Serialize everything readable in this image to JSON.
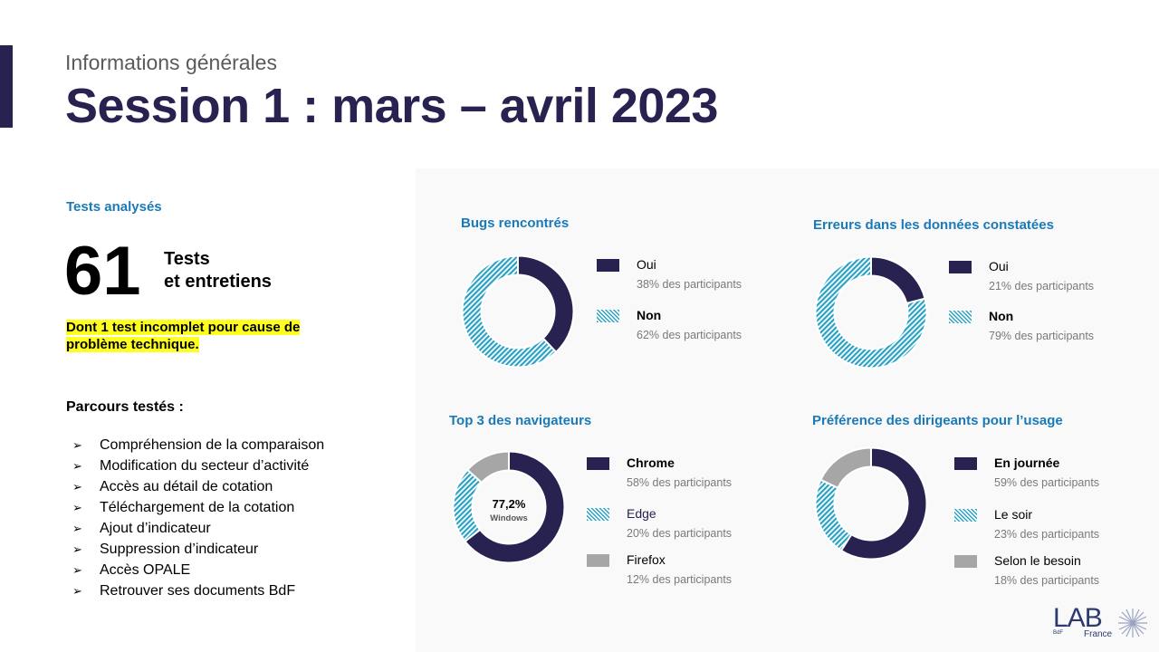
{
  "header": {
    "subtitle": "Informations générales",
    "title": "Session 1 : mars – avril 2023"
  },
  "summary": {
    "heading": "Tests analysés",
    "count": "61",
    "count_label_line1": "Tests",
    "count_label_line2": "et entretiens",
    "note": "Dont 1 test incomplet pour cause de problème technique."
  },
  "parcours": {
    "title": "Parcours testés :",
    "bullet": "➢",
    "items": [
      "Compréhension de la comparaison",
      "Modification du secteur d’activité",
      "Accès au détail de cotation",
      "Téléchargement de la cotation",
      "Ajout d’indicateur",
      "Suppression d’indicateur",
      "Accès OPALE",
      "Retrouver ses documents BdF"
    ]
  },
  "colors": {
    "navy": "#27224f",
    "teal": "#2aa2c4",
    "gray": "#a6a6a6",
    "heading_blue": "#1a7ab8",
    "highlight": "#ffff1f"
  },
  "chart_data": [
    {
      "type": "pie",
      "title": "Bugs rencontrés",
      "categories": [
        "Oui",
        "Non"
      ],
      "values": [
        38,
        62
      ],
      "legend_sub": [
        "38% des participants",
        "62% des participants"
      ],
      "styles": [
        "navy",
        "teal-hatch"
      ]
    },
    {
      "type": "pie",
      "title": "Erreurs dans les données constatées",
      "categories": [
        "Oui",
        "Non"
      ],
      "values": [
        21,
        79
      ],
      "legend_sub": [
        "21% des participants",
        "79% des participants"
      ],
      "styles": [
        "navy",
        "teal-hatch"
      ]
    },
    {
      "type": "pie",
      "title": "Top 3 des navigateurs",
      "categories": [
        "Chrome",
        "Edge",
        "Firefox"
      ],
      "values": [
        58,
        20,
        12
      ],
      "legend_sub": [
        "58% des participants",
        "20% des participants",
        "12% des participants"
      ],
      "styles": [
        "navy",
        "teal-hatch",
        "gray"
      ],
      "center_value": "77,2%",
      "center_label": "Windows"
    },
    {
      "type": "pie",
      "title": "Préférence des dirigeants pour l’usage",
      "categories": [
        "En journée",
        "Le soir",
        "Selon le besoin"
      ],
      "values": [
        59,
        23,
        18
      ],
      "legend_sub": [
        "59% des participants",
        "23% des participants",
        "18% des participants"
      ],
      "styles": [
        "navy",
        "teal-hatch",
        "gray"
      ]
    }
  ],
  "logo": {
    "text": "LAB",
    "sub": "France",
    "small": "BdF"
  }
}
